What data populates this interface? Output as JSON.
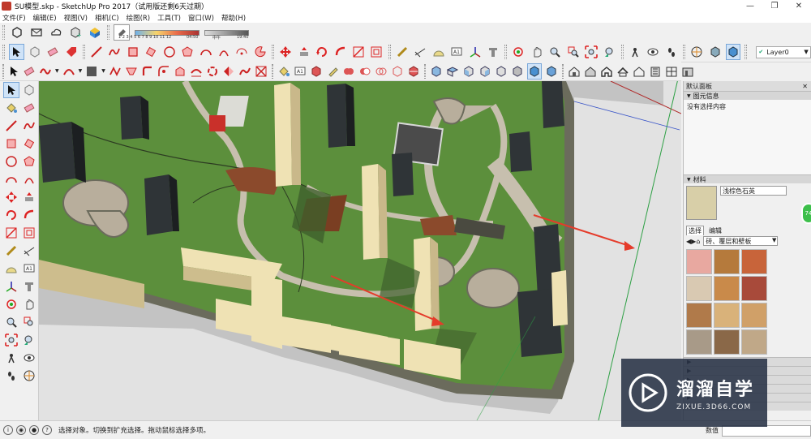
{
  "window": {
    "title": "SU模型.skp - SketchUp Pro 2017（试用版还剩6天过期）",
    "min": "—",
    "max": "❐",
    "close": "✕"
  },
  "menu": [
    "文件(F)",
    "编辑(E)",
    "视图(V)",
    "相机(C)",
    "绘图(R)",
    "工具(T)",
    "窗口(W)",
    "帮助(H)"
  ],
  "shadow_settings": {
    "months": "1 2 3 4 5 6 7 8 9 10 11 12",
    "time_start": "04:50",
    "time_mid": "中午",
    "time_end": "19:40"
  },
  "layer": {
    "current": "Layer0"
  },
  "default_tray": {
    "title": "默认面板",
    "close": "✕"
  },
  "entity_info": {
    "header": "图元信息",
    "content": "没有选择内容"
  },
  "materials": {
    "header": "材料",
    "current_name": "浅棕色石英",
    "tab_select": "选择",
    "tab_edit": "编辑",
    "collection": "砖、覆层和壁板",
    "swatches": [
      "#e8a8a0",
      "#b57a3c",
      "#c8643a",
      "#d9c9b2",
      "#c98a4a",
      "#a84a3a",
      "#b07a4a",
      "#d9b27a",
      "#d0a068",
      "#a89a88",
      "#8a6848",
      "#c0a888"
    ]
  },
  "status": {
    "message": "选择对象。切换到扩充选择。拖动鼠标选择多项。",
    "measure_label": "数值"
  },
  "watermark": {
    "brand": "溜溜自学",
    "url": "ZIXUE.3D66.COM"
  },
  "badge": {
    "text": "74"
  },
  "colors": {
    "grass": "#5c8f3c",
    "path": "#c9c0b0",
    "building_cream": "#efe2b4",
    "arrow": "#e53b2a"
  },
  "icons": {
    "toolbar_row1": [
      "select-arrow-icon",
      "rectangle-icon",
      "eraser-icon",
      "shadow-icon"
    ],
    "toolbar_row2": [
      "select-icon",
      "eraser-icon",
      "freehand-icon",
      "arc-icon",
      "pushpull-icon",
      "move-icon",
      "rotate-icon",
      "scale-icon",
      "offset-icon",
      "tape-icon",
      "text-icon",
      "axes-icon",
      "orbit-icon",
      "pan-icon",
      "zoom-icon",
      "zoom-window-icon",
      "zoom-extents-icon",
      "walk-icon",
      "look-around-icon",
      "position-camera-icon",
      "section-icon",
      "component-icon",
      "layer-icon"
    ],
    "toolbar_row3": [
      "select-icon",
      "paint-icon",
      "line-icon",
      "arc-icon",
      "polygon-icon",
      "circle-icon",
      "followme-icon",
      "intersect-icon",
      "solid-tools-icon",
      "iso-view-icon",
      "top-view-icon",
      "front-view-icon",
      "right-view-icon",
      "back-view-icon",
      "left-view-icon",
      "xray-icon",
      "wireframe-icon",
      "hidden-line-icon",
      "shaded-icon",
      "textured-icon",
      "monochrome-icon",
      "warehouse-icon",
      "extension-icon",
      "house-icon"
    ],
    "left_toolbar": [
      "select-icon",
      "make-component-icon",
      "paint-bucket-icon",
      "eraser-icon",
      "line-icon",
      "freehand-icon",
      "rectangle-icon",
      "rotated-rect-icon",
      "circle-icon",
      "polygon-icon",
      "arc-icon",
      "pie-icon",
      "move-icon",
      "pushpull-icon",
      "rotate-icon",
      "followme-icon",
      "scale-icon",
      "offset-icon",
      "tape-icon",
      "dimension-icon",
      "protractor-icon",
      "text-icon",
      "axes-icon",
      "3d-text-icon",
      "orbit-icon",
      "pan-icon",
      "zoom-icon",
      "zoom-window-icon",
      "zoom-extents-icon",
      "previous-view-icon",
      "position-camera-icon",
      "look-around-icon",
      "walk-icon",
      "section-plane-icon"
    ]
  }
}
